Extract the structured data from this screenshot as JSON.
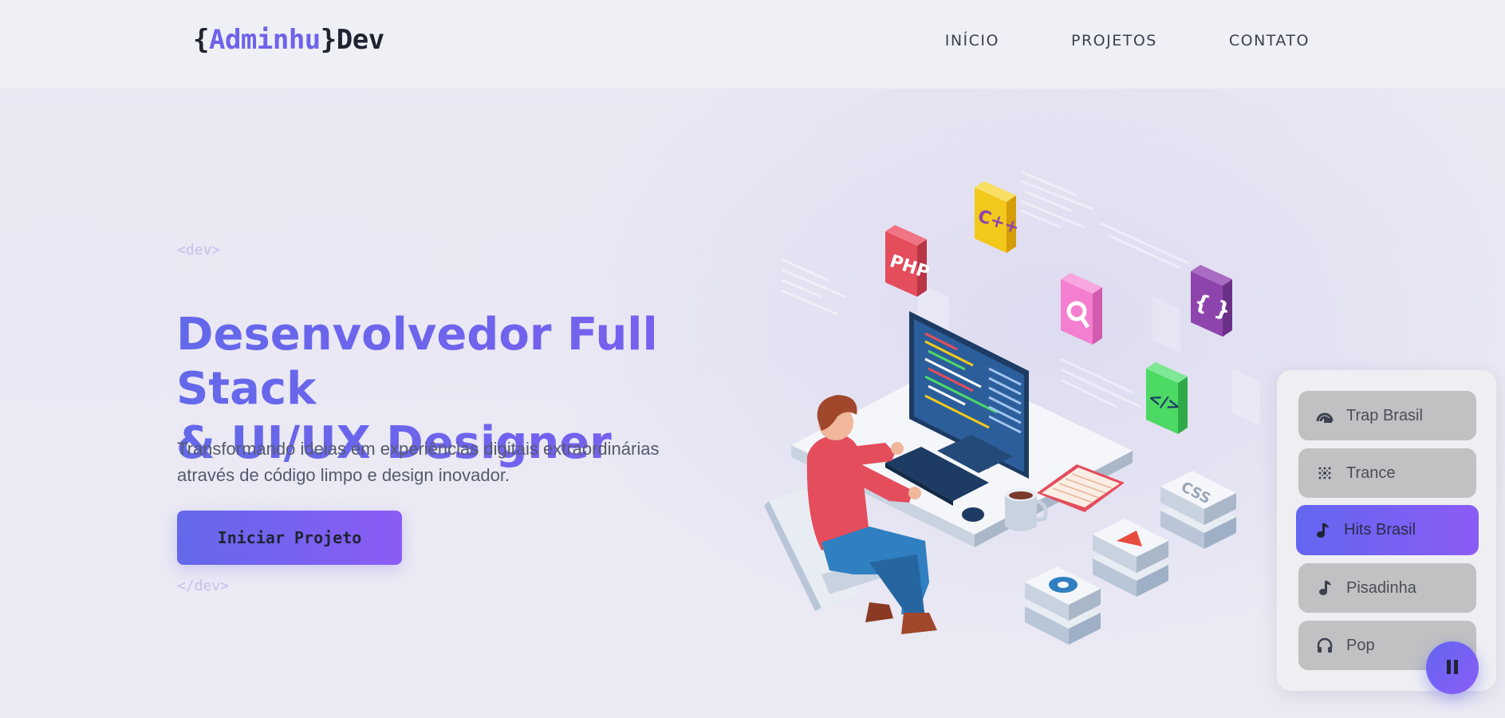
{
  "brand": {
    "open_brace": "{",
    "name_accent": "Adminhu",
    "close_brace": "}",
    "name_suffix": "Dev",
    "accent_color": "#6e63ea"
  },
  "nav": {
    "items": [
      {
        "label": "INÍCIO"
      },
      {
        "label": "PROJETOS"
      },
      {
        "label": "CONTATO"
      }
    ]
  },
  "hero": {
    "tag_open": "<dev>",
    "title_line1": "Desenvolvedor Full Stack",
    "title_line2": "& UI/UX Designer",
    "subtitle_line1": "Transformando ideias em experiências digitais extraordinárias",
    "subtitle_line2": "através de código limpo e design inovador.",
    "cta_label": "Iniciar Projeto",
    "tag_close": "</dev>"
  },
  "illustration": {
    "tiles": [
      {
        "label": "PHP",
        "color": "#e44d5c"
      },
      {
        "label": "C++",
        "color": "#f2c81b"
      },
      {
        "label": "{ }",
        "color": "#8e44ad"
      },
      {
        "label": "</>",
        "color": "#4cd964"
      },
      {
        "label": "CSS",
        "color": "#e6eaf0"
      }
    ]
  },
  "music_player": {
    "stations": [
      {
        "label": "Trap Brasil",
        "icon": "rainbow-icon",
        "active": false
      },
      {
        "label": "Trance",
        "icon": "waveform-grid-icon",
        "active": false
      },
      {
        "label": "Hits Brasil",
        "icon": "music-note-icon",
        "active": true
      },
      {
        "label": "Pisadinha",
        "icon": "music-note-icon",
        "active": false
      },
      {
        "label": "Pop",
        "icon": "headphones-icon",
        "active": false
      }
    ],
    "state": "playing",
    "control_icon": "pause-icon",
    "active_color": "#6366f1"
  }
}
